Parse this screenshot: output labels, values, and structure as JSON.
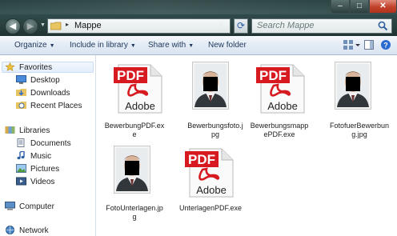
{
  "window": {
    "controls": {
      "minimize": "–",
      "maximize": "□",
      "close": "✕"
    }
  },
  "address": {
    "path": "Mappe",
    "separator": "▸"
  },
  "search": {
    "placeholder": "Search Mappe"
  },
  "toolbar": {
    "organize": "Organize",
    "include": "Include in library",
    "share": "Share with",
    "newfolder": "New folder"
  },
  "nav": {
    "favorites": "Favorites",
    "desktop": "Desktop",
    "downloads": "Downloads",
    "recent": "Recent Places",
    "libraries": "Libraries",
    "documents": "Documents",
    "music": "Music",
    "pictures": "Pictures",
    "videos": "Videos",
    "computer": "Computer",
    "network": "Network"
  },
  "pdf_icon": {
    "label": "PDF",
    "brand": "Adobe",
    "color": "#d71920"
  },
  "files": [
    {
      "name_l1": "BewerbungPDF.ex",
      "name_l2": "e",
      "type": "pdf-icon"
    },
    {
      "name_l1": "Bewerbungsfoto.j",
      "name_l2": "pg",
      "type": "photo-icon"
    },
    {
      "name_l1": "Bewerbungsmapp",
      "name_l2": "ePDF.exe",
      "type": "pdf-icon"
    },
    {
      "name_l1": "FotofuerBewerbun",
      "name_l2": "g.jpg",
      "type": "photo-icon"
    },
    {
      "name_l1": "FotoUnterlagen.jp",
      "name_l2": "g",
      "type": "photo-icon"
    },
    {
      "name_l1": "UnterlagenPDF.exe",
      "name_l2": "",
      "type": "pdf-icon"
    }
  ]
}
